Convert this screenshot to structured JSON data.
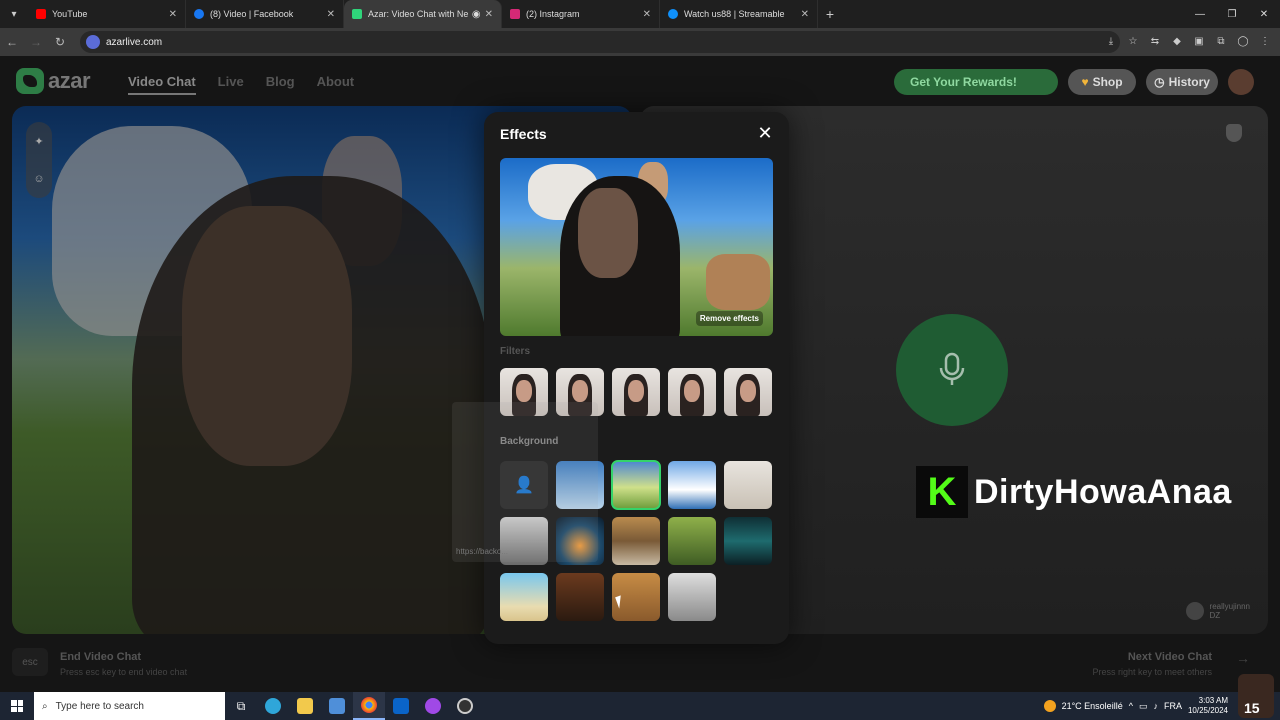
{
  "browser": {
    "tabs": [
      {
        "title": "YouTube",
        "color": "#ff0000",
        "active": false
      },
      {
        "title": "(8) Video | Facebook",
        "color": "#1877f2",
        "active": false
      },
      {
        "title": "Azar: Video Chat with New",
        "color": "#2fd47a",
        "active": true
      },
      {
        "title": "(2) Instagram",
        "color": "#d62976",
        "active": false
      },
      {
        "title": "Watch us88 | Streamable",
        "color": "#0f90fa",
        "active": false
      }
    ],
    "url": "azarlive.com"
  },
  "header": {
    "logo_text": "azar",
    "nav": [
      "Video Chat",
      "Live",
      "Blog",
      "About"
    ],
    "rewards_label": "Get Your Rewards!",
    "shop_label": "Shop",
    "history_label": "History"
  },
  "stream_overlay": {
    "kick_letter": "K",
    "streamer_name": "DirtyHowaAnaa"
  },
  "peer": {
    "name": "reallyujinnn",
    "country": "DZ"
  },
  "effects": {
    "title": "Effects",
    "remove_label": "Remove effects",
    "filters_label": "Filters",
    "background_label": "Background",
    "ghost_url": "https://backo..."
  },
  "footer": {
    "esc_key": "esc",
    "end_title": "End Video Chat",
    "end_sub": "Press esc key to end video chat",
    "next_title": "Next Video Chat",
    "next_sub": "Press right key to meet others"
  },
  "taskbar": {
    "search_placeholder": "Type here to search",
    "weather": "21°C Ensoleillé",
    "lang": "FRA",
    "time": "3:03 AM",
    "date": "10/25/2024",
    "badge": "15"
  }
}
